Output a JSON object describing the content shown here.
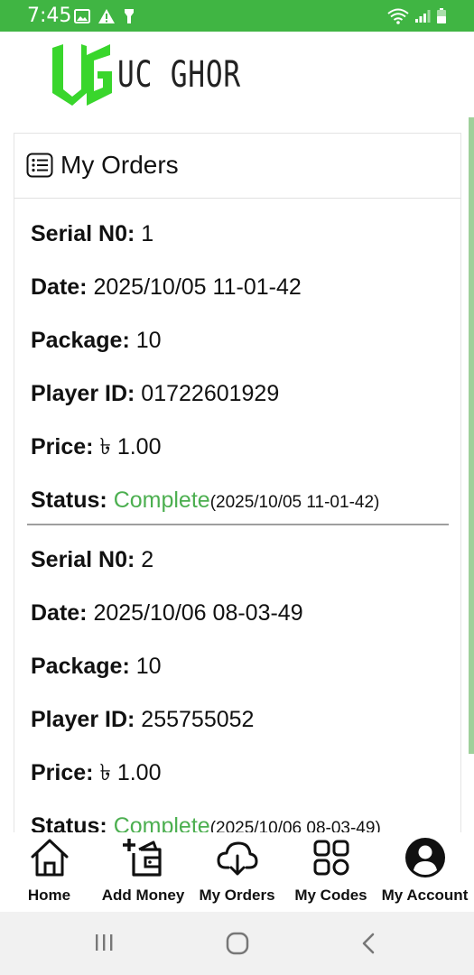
{
  "status_bar": {
    "time": "7:45",
    "color": "#40b543"
  },
  "header": {
    "logo_mark": "UG",
    "logo_text": "UC GHOR",
    "logo_color": "#39d62c"
  },
  "page": {
    "title": "My Orders",
    "title_icon": "list-icon"
  },
  "orders": [
    {
      "serial_label": "Serial N0:",
      "serial": "1",
      "date_label": "Date:",
      "date": "2025/10/05 11-01-42",
      "package_label": "Package:",
      "package": "10",
      "player_label": "Player ID:",
      "player_id": "01722601929",
      "price_label": "Price:",
      "price": "৳ 1.00",
      "status_label": "Status:",
      "status": "Complete",
      "status_time": "(2025/10/05 11-01-42)"
    },
    {
      "serial_label": "Serial N0:",
      "serial": "2",
      "date_label": "Date:",
      "date": "2025/10/06 08-03-49",
      "package_label": "Package:",
      "package": "10",
      "player_label": "Player ID:",
      "player_id": "255755052",
      "price_label": "Price:",
      "price": "৳ 1.00",
      "status_label": "Status:",
      "status": "Complete",
      "status_time": "(2025/10/06 08-03-49)"
    }
  ],
  "colors": {
    "status_complete": "#4caf50",
    "divider": "#9e9e9e"
  },
  "bottom_nav": {
    "items": [
      {
        "label": "Home",
        "icon": "home-icon"
      },
      {
        "label": "Add Money",
        "icon": "add-wallet-icon"
      },
      {
        "label": "My Orders",
        "icon": "cloud-download-icon"
      },
      {
        "label": "My Codes",
        "icon": "grid-icon"
      },
      {
        "label": "My Account",
        "icon": "account-icon"
      }
    ]
  },
  "system_nav": {
    "buttons": [
      "recents-icon",
      "home-circle-icon",
      "back-icon"
    ]
  }
}
